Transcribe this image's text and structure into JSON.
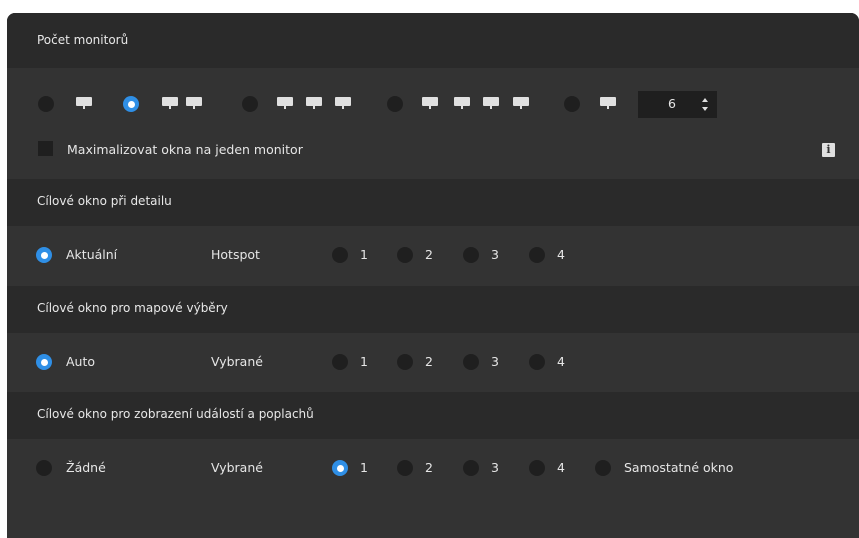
{
  "sections": {
    "monitors": {
      "title": "Počet monitorů",
      "count_value": "6",
      "maximize_label": "Maximalizovat okna na jeden monitor",
      "options": [
        {
          "monitors": 1,
          "selected": false
        },
        {
          "monitors": 2,
          "selected": true
        },
        {
          "monitors": 3,
          "selected": false
        },
        {
          "monitors": 4,
          "selected": false
        },
        {
          "monitors": "custom",
          "selected": false
        }
      ]
    },
    "detail": {
      "title": "Cílové okno při detailu",
      "current_label": "Aktuální",
      "hotspot_label": "Hotspot",
      "numbers": [
        "1",
        "2",
        "3",
        "4"
      ],
      "selected": "Aktuální"
    },
    "map": {
      "title": "Cílové okno pro mapové výběry",
      "auto_label": "Auto",
      "selected_label": "Vybrané",
      "numbers": [
        "1",
        "2",
        "3",
        "4"
      ],
      "selected": "Auto"
    },
    "events": {
      "title": "Cílové okno pro zobrazení událostí a poplachů",
      "none_label": "Žádné",
      "selected_label": "Vybrané",
      "numbers": [
        "1",
        "2",
        "3",
        "4"
      ],
      "standalone_label": "Samostatné okno",
      "selected": "1"
    }
  },
  "colors": {
    "panel": "#333333",
    "header": "#2a2a2a",
    "accent": "#2f8fe6"
  }
}
